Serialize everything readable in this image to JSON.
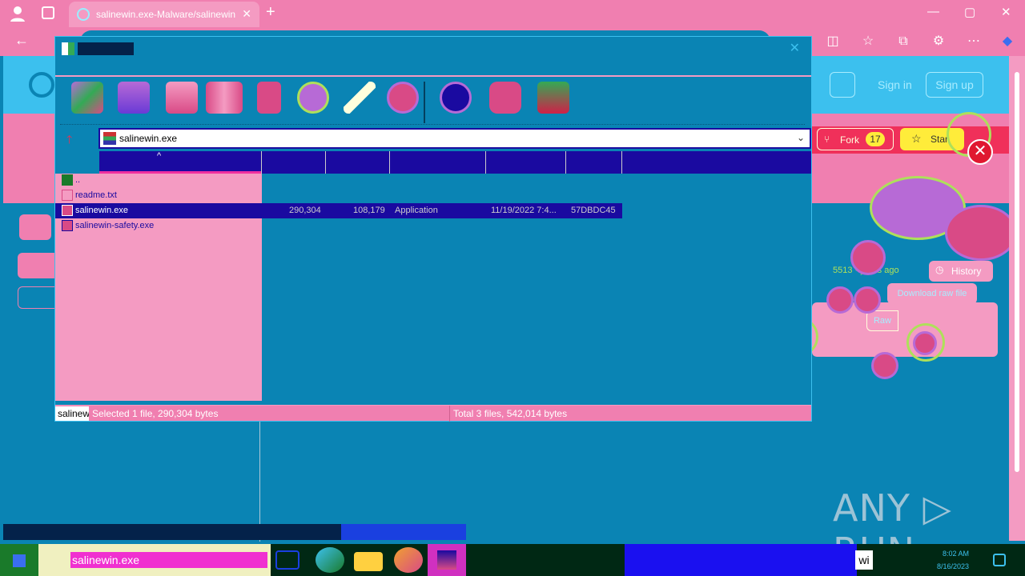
{
  "browser": {
    "tab_title": "salinewin.exe-Malware/salinewin",
    "tab_close": "✕",
    "new_tab": "+",
    "minimize": "—",
    "maximize": "▢",
    "close": "✕"
  },
  "github": {
    "sign_in": "Sign in",
    "sign_up": "Sign up",
    "fork_label": "Fork",
    "fork_count": "17",
    "star_label": "Star",
    "history_label": "History",
    "commit_text": "5513",
    "commit_time": "years ago",
    "download_raw": "Download raw file",
    "raw_label": "Raw"
  },
  "winrar": {
    "path": "salinewin.exe",
    "files": [
      {
        "name": "..",
        "size": "",
        "packed": "",
        "type": "",
        "modified": "",
        "crc": "",
        "selected": false,
        "icon": "folder-up"
      },
      {
        "name": "readme.txt",
        "size": "",
        "packed": "",
        "type": "",
        "modified": "",
        "crc": "",
        "selected": false,
        "icon": "text"
      },
      {
        "name": "salinewin.exe",
        "size": "290,304",
        "packed": "108,179",
        "type": "Application",
        "modified": "11/19/2022 7:4...",
        "crc": "57DBDC45",
        "selected": true,
        "icon": "app"
      },
      {
        "name": "salinewin-safety.exe",
        "size": "",
        "packed": "",
        "type": "",
        "modified": "",
        "crc": "",
        "selected": false,
        "icon": "app"
      }
    ],
    "status_mini": "salinew",
    "status_left": "Selected 1 file, 290,304 bytes",
    "status_right": "Total 3 files, 542,014 bytes",
    "toolbar_icons": [
      "add-icon",
      "extract-icon",
      "test-icon",
      "view-icon",
      "delete-icon",
      "find-icon",
      "wizard-icon",
      "info-icon",
      "virus-scan-icon",
      "comment-icon",
      "sfx-icon"
    ]
  },
  "watermark": "ANY ▷ RUN",
  "taskbar": {
    "search_text": "salinewin.exe",
    "tray_label": "wi",
    "clock_time": "8:02 AM",
    "clock_date": "8/16/2023"
  },
  "colors": {
    "chrome": "#f07fb0",
    "page": "#0a84b4",
    "selection": "#1a0aa0",
    "taskbar": "#002814"
  }
}
